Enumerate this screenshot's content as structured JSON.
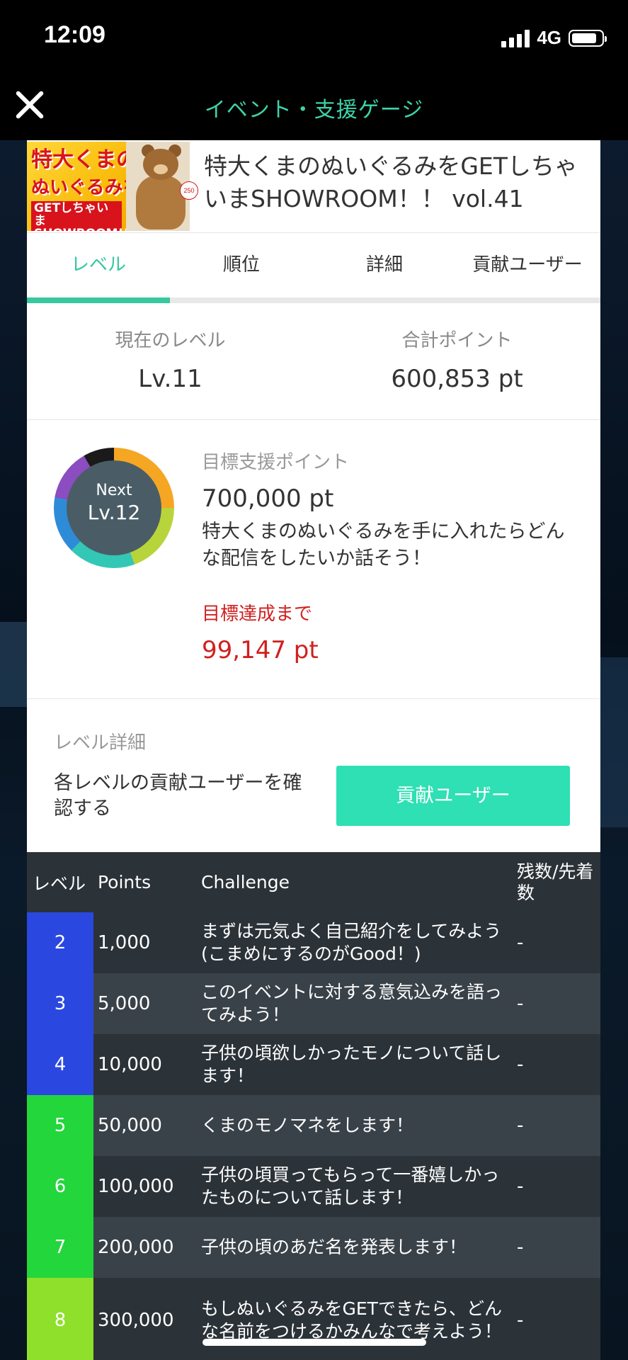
{
  "status_bar": {
    "time": "12:09",
    "network": "4G"
  },
  "header": {
    "title": "イベント・支援ゲージ"
  },
  "event": {
    "title": "特大くまのぬいぐるみをGETしちゃいまSHOWROOM！！ vol.41",
    "thumbnail": {
      "line1": "特大くまの",
      "line2": "ぬいぐるみを",
      "line3": "GETしちゃいま SHOWROOM!!",
      "size_badge": "250"
    }
  },
  "tabs": [
    {
      "label": "レベル",
      "active": true
    },
    {
      "label": "順位",
      "active": false
    },
    {
      "label": "詳細",
      "active": false
    },
    {
      "label": "貢献ユーザー",
      "active": false
    }
  ],
  "current_level": {
    "caption": "現在のレベル",
    "value": "Lv.11"
  },
  "total_points": {
    "caption": "合計ポイント",
    "value": "600,853 pt"
  },
  "next": {
    "label": "Next",
    "level": "Lv.12",
    "target_caption": "目標支援ポイント",
    "target_value": "700,000 pt",
    "description": "特大くまのぬいぐるみを手に入れたらどんな配信をしたいか話そう！",
    "remaining_caption": "目標達成まで",
    "remaining_value": "99,147 pt"
  },
  "level_detail": {
    "caption": "レベル詳細",
    "description": "各レベルの貢献ユーザーを確認する",
    "button": "貢献ユーザー"
  },
  "table": {
    "headers": {
      "level": "レベル",
      "points": "Points",
      "challenge": "Challenge",
      "remaining": "残数/先着数"
    },
    "rows": [
      {
        "level": "2",
        "points": "1,000",
        "challenge": "まずは元気よく自己紹介をしてみよう(こまめにするのがGood！)",
        "remaining": "-",
        "color": "#2a48e0"
      },
      {
        "level": "3",
        "points": "5,000",
        "challenge": "このイベントに対する意気込みを語ってみよう！",
        "remaining": "-",
        "color": "#2a48e0"
      },
      {
        "level": "4",
        "points": "10,000",
        "challenge": "子供の頃欲しかったモノについて話します！",
        "remaining": "-",
        "color": "#2a48e0"
      },
      {
        "level": "5",
        "points": "50,000",
        "challenge": "くまのモノマネをします！",
        "remaining": "-",
        "color": "#22d63c"
      },
      {
        "level": "6",
        "points": "100,000",
        "challenge": "子供の頃買ってもらって一番嬉しかったものについて話します！",
        "remaining": "-",
        "color": "#22d63c"
      },
      {
        "level": "7",
        "points": "200,000",
        "challenge": "子供の頃のあだ名を発表します！",
        "remaining": "-",
        "color": "#22d63c"
      },
      {
        "level": "8",
        "points": "300,000",
        "challenge": "もしぬいぐるみをGETできたら、どんな名前をつけるかみんなで考えよう！",
        "remaining": "-",
        "color": "#8ee02a"
      }
    ]
  }
}
